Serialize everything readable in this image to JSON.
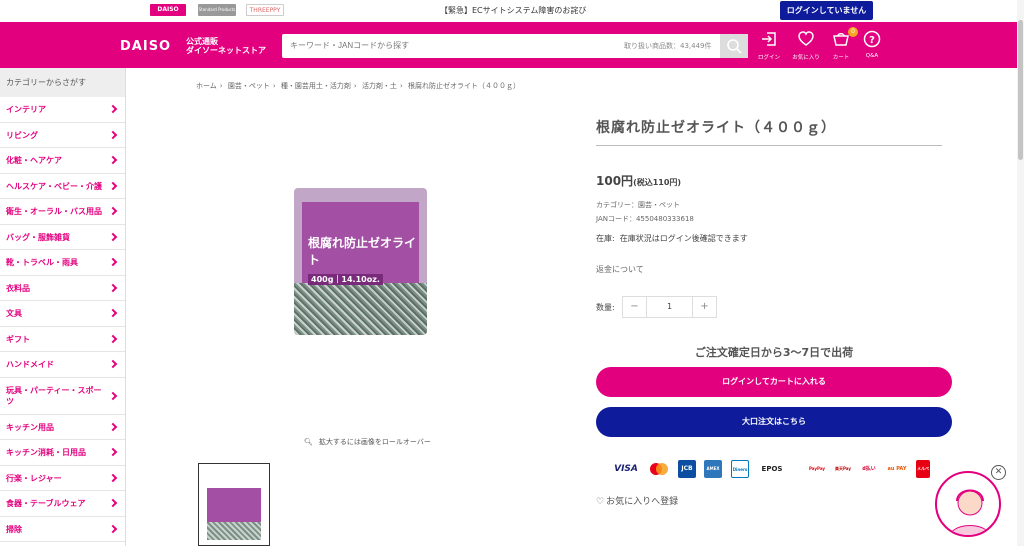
{
  "topbar": {
    "brands": [
      "DAISO",
      "Standard Products",
      "THREEPPY"
    ],
    "notice": "【緊急】ECサイトシステム障害のお詫び",
    "login_status": "ログインしていません"
  },
  "header": {
    "logo": "DAISO",
    "logo_sub_1": "公式通販",
    "logo_sub_2": "ダイソーネットストア",
    "search_placeholder": "キーワード・JANコードから探す",
    "item_count": "取り扱い商品数：43,449件",
    "cart_count": "0",
    "icons": {
      "login": "ログイン",
      "favorites": "お気に入り",
      "cart": "カート",
      "qa": "Q&A"
    },
    "accent": "#e3007f",
    "navy": "#0e1c9c"
  },
  "sidebar": {
    "heading": "カテゴリーからさがす",
    "items": [
      "インテリア",
      "リビング",
      "化粧・ヘアケア",
      "ヘルスケア・ベビー・介護",
      "衛生・オーラル・バス用品",
      "バッグ・服飾雑貨",
      "靴・トラベル・雨具",
      "衣料品",
      "文具",
      "ギフト",
      "ハンドメイド",
      "玩具・パーティー・スポーツ",
      "キッチン用品",
      "キッチン消耗・日用品",
      "行楽・レジャー",
      "食器・テーブルウェア",
      "掃除"
    ]
  },
  "breadcrumb": [
    "ホーム",
    "園芸・ペット",
    "種・園芸用土・活力剤",
    "活力剤・土",
    "根腐れ防止ゼオライト（４００ｇ）"
  ],
  "product": {
    "title": "根腐れ防止ゼオライト（４００ｇ）",
    "price": "100円",
    "price_tax": "(税込110円)",
    "category": "カテゴリー：園芸・ペット",
    "jan": "JANコード：4550480333618",
    "stock_label": "在庫:",
    "stock_value": "在庫状況はログイン後確認できます",
    "refund": "返金について",
    "qty_label": "数量:",
    "qty_value": "1",
    "qty_minus": "−",
    "qty_plus": "+",
    "delivery": "ご注文確定日から3〜7日で出荷",
    "cart_button": "ログインしてカートに入れる",
    "bulk_button": "大口注文はこちら",
    "favorite": "お気に入りへ登録",
    "zoom_hint": "拡大するには画像をロールオーバー",
    "image_title": "根腐れ防止ゼオライト",
    "image_weight": "400g｜14.10oz."
  },
  "payments": [
    "VISA",
    "Mastercard",
    "JCB",
    "AMEX",
    "Diners",
    "EPOS",
    "PayPay",
    "楽天Pay",
    "d払い",
    "au PAY",
    "メルペイ"
  ]
}
